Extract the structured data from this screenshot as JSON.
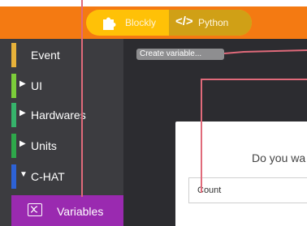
{
  "toolbar": {
    "blockly_label": "Blockly",
    "python_label": "Python",
    "python_icon": "</>"
  },
  "sidebar": {
    "items": [
      {
        "label": "Event",
        "color": "#e8b23a",
        "arrow": ""
      },
      {
        "label": "UI",
        "color": "#7ccd3a",
        "arrow": "▶"
      },
      {
        "label": "Hardwares",
        "color": "#36b36b",
        "arrow": "▶"
      },
      {
        "label": "Units",
        "color": "#2ea84a",
        "arrow": "▶"
      },
      {
        "label": "C-HAT",
        "color": "#2d62d6",
        "arrow": "▼"
      }
    ],
    "variables_label": "Variables"
  },
  "workspace": {
    "create_variable_label": "Create variable..."
  },
  "dialog": {
    "prompt": "Do you wa",
    "input_value": "Count"
  },
  "colors": {
    "topbar": "#f47a12",
    "toggle": "#ffc107",
    "variables": "#9a2ab0",
    "callout": "#e06a7a"
  }
}
